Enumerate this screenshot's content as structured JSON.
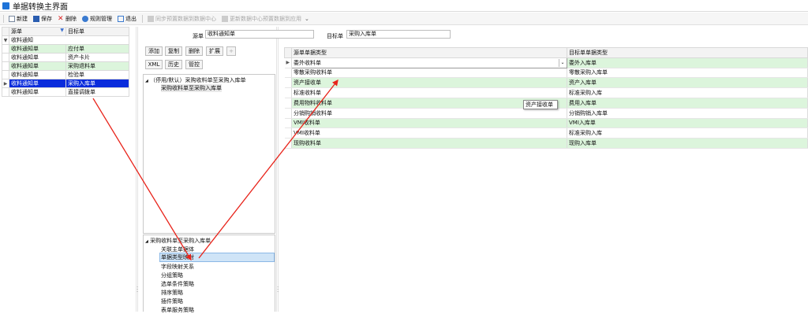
{
  "window": {
    "title": "单据转换主界面"
  },
  "toolbar": {
    "new_label": "新建",
    "save_label": "保存",
    "delete_label": "删除",
    "rule_label": "规则管理",
    "exit_label": "退出",
    "sync_label": "同步预置数据到数据中心",
    "update_label": "更新数据中心预置数据到应用"
  },
  "left_grid": {
    "headers": [
      "源单",
      "目标单"
    ],
    "group": "收料通知",
    "rows": [
      {
        "source": "收料通知单",
        "target": "应付单"
      },
      {
        "source": "收料通知单",
        "target": "资产卡片"
      },
      {
        "source": "收料通知单",
        "target": "采购退料单"
      },
      {
        "source": "收料通知单",
        "target": "检验单"
      },
      {
        "source": "收料通知单",
        "target": "采购入库单"
      },
      {
        "source": "收料通知单",
        "target": "直接调拨单"
      }
    ]
  },
  "header_fields": {
    "source_label": "源单",
    "source_value": "收料通知单",
    "target_label": "目标单",
    "target_value": "采购入库单"
  },
  "mid_buttons": {
    "add": "添加",
    "copy": "复制",
    "delete": "删除",
    "expand": "扩展",
    "plus": "+",
    "xml": "XML",
    "history": "历史",
    "control": "管控"
  },
  "upper_tree": {
    "root": "（停用/默认）采购收料单至采购入库单",
    "child": "采购收料单至采购入库单"
  },
  "lower_tree": {
    "root": "采购收料单至采购入库单",
    "items": [
      "关联主单据体",
      "单据类型映射",
      "字段映射关系",
      "分组策略",
      "选单条件策略",
      "排序策略",
      "插件策略",
      "表单服务策略"
    ]
  },
  "right_grid": {
    "headers": [
      "源单单据类型",
      "目标单单据类型"
    ],
    "rows": [
      {
        "source": "委外收料单",
        "target": "委外入库单"
      },
      {
        "source": "零散采购收料单",
        "target": "零散采购入库单"
      },
      {
        "source": "资产接收单",
        "target": "资产入库单"
      },
      {
        "source": "标准收料单",
        "target": "标准采购入库"
      },
      {
        "source": "费用物料收料单",
        "target": "费用入库单"
      },
      {
        "source": "分销购销收料单",
        "target": "分销购销入库单"
      },
      {
        "source": "VMI收料单",
        "target": "VMI入库单"
      },
      {
        "source": "VMI收料单",
        "target": "标准采购入库"
      },
      {
        "source": "现购收料单",
        "target": "现购入库单"
      }
    ]
  },
  "tooltip": "资产接收单",
  "colors": {
    "green_row": "#dcf5dc",
    "selected_row": "#0a2cdc",
    "arrow": "#e8231a"
  }
}
